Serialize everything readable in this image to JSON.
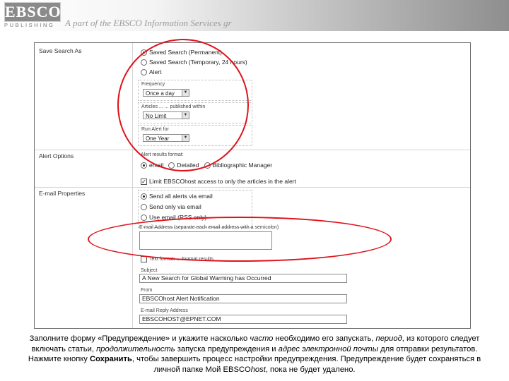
{
  "header": {
    "logo_text": "EBSCO",
    "logo_subtext": "PUBLISHING",
    "tagline": "A part of the EBSCO Information Services gr"
  },
  "form": {
    "save_search_as": {
      "label": "Save Search As",
      "options": [
        {
          "label": "Saved Search (Permanent)",
          "selected": true
        },
        {
          "label": "Saved Search (Temporary, 24 hours)",
          "selected": false
        },
        {
          "label": "Alert",
          "selected": false
        }
      ],
      "frequency": {
        "label": "Frequency",
        "value": "Once a day"
      },
      "articles": {
        "label": "Articles ... ... published within",
        "value": "No Limit"
      },
      "run_for": {
        "label": "Run Alert for",
        "value": "One Year"
      }
    },
    "alert_options": {
      "label": "Alert Options",
      "results_format_label": "Alert results format:",
      "formats": [
        {
          "label": "email",
          "selected": true
        },
        {
          "label": "Detailed",
          "selected": false
        },
        {
          "label": "Bibliographic Manager",
          "selected": false
        }
      ],
      "limit_label": "Limit EBSCOhost access to only the articles in the alert",
      "limit_checked": true
    },
    "email_properties": {
      "label": "E-mail Properties",
      "options": [
        {
          "label": "Send all alerts via email",
          "selected": true
        },
        {
          "label": "Send only via email",
          "selected": false
        },
        {
          "label": "Use email (RSS only)",
          "selected": false
        }
      ],
      "address_label": "E-mail Address (separate each email address with a semicolon)",
      "address_value": "",
      "format_check_label": "Text format: ... Format results",
      "subject_label": "Subject",
      "subject_value": "A New Search for Global Warming has Occurred",
      "from_label": "From",
      "from_value": "EBSCOhost Alert Notification",
      "reply_label": "E-mail Reply Address",
      "reply_value": "EBSCOHOST@EPNET.COM"
    }
  },
  "caption": {
    "p1": "Заполните форму «Предупреждение» и укажите насколько ",
    "e1": "часто",
    "p2": " необходимо его запускать, ",
    "e2": "период",
    "p3": ", из которого следует включать статьи, ",
    "e3": "продолжительность",
    "p4": " запуска предупреждения и ",
    "e4": "адрес электронной почты",
    "p5": " для отправки результатов. Нажмите кнопку ",
    "b1": "Сохранить",
    "p6": ", чтобы завершить процесс настройки предупреждения. Предупреждение будет сохраняться в личной папке Мой EBSCO",
    "e5": "host",
    "p7": ", пока не будет удалено."
  },
  "colors": {
    "annotation_red": "#e0121b",
    "banner_gray": "#8e8e8e"
  }
}
